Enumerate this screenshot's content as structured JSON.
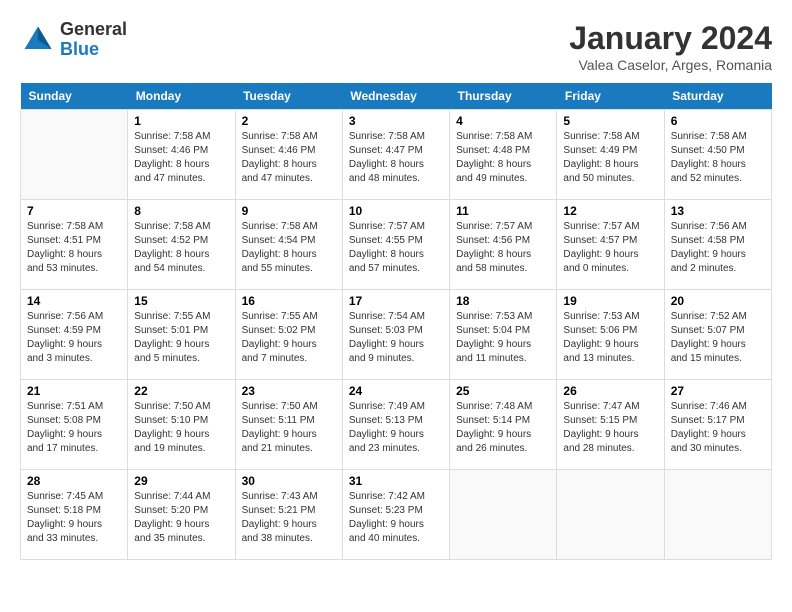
{
  "header": {
    "logo": {
      "general": "General",
      "blue": "Blue"
    },
    "title": "January 2024",
    "location": "Valea Caselor, Arges, Romania"
  },
  "days_of_week": [
    "Sunday",
    "Monday",
    "Tuesday",
    "Wednesday",
    "Thursday",
    "Friday",
    "Saturday"
  ],
  "weeks": [
    [
      {
        "day": "",
        "info": ""
      },
      {
        "day": "1",
        "info": "Sunrise: 7:58 AM\nSunset: 4:46 PM\nDaylight: 8 hours\nand 47 minutes."
      },
      {
        "day": "2",
        "info": "Sunrise: 7:58 AM\nSunset: 4:46 PM\nDaylight: 8 hours\nand 47 minutes."
      },
      {
        "day": "3",
        "info": "Sunrise: 7:58 AM\nSunset: 4:47 PM\nDaylight: 8 hours\nand 48 minutes."
      },
      {
        "day": "4",
        "info": "Sunrise: 7:58 AM\nSunset: 4:48 PM\nDaylight: 8 hours\nand 49 minutes."
      },
      {
        "day": "5",
        "info": "Sunrise: 7:58 AM\nSunset: 4:49 PM\nDaylight: 8 hours\nand 50 minutes."
      },
      {
        "day": "6",
        "info": "Sunrise: 7:58 AM\nSunset: 4:50 PM\nDaylight: 8 hours\nand 52 minutes."
      }
    ],
    [
      {
        "day": "7",
        "info": "Sunrise: 7:58 AM\nSunset: 4:51 PM\nDaylight: 8 hours\nand 53 minutes."
      },
      {
        "day": "8",
        "info": "Sunrise: 7:58 AM\nSunset: 4:52 PM\nDaylight: 8 hours\nand 54 minutes."
      },
      {
        "day": "9",
        "info": "Sunrise: 7:58 AM\nSunset: 4:54 PM\nDaylight: 8 hours\nand 55 minutes."
      },
      {
        "day": "10",
        "info": "Sunrise: 7:57 AM\nSunset: 4:55 PM\nDaylight: 8 hours\nand 57 minutes."
      },
      {
        "day": "11",
        "info": "Sunrise: 7:57 AM\nSunset: 4:56 PM\nDaylight: 8 hours\nand 58 minutes."
      },
      {
        "day": "12",
        "info": "Sunrise: 7:57 AM\nSunset: 4:57 PM\nDaylight: 9 hours\nand 0 minutes."
      },
      {
        "day": "13",
        "info": "Sunrise: 7:56 AM\nSunset: 4:58 PM\nDaylight: 9 hours\nand 2 minutes."
      }
    ],
    [
      {
        "day": "14",
        "info": "Sunrise: 7:56 AM\nSunset: 4:59 PM\nDaylight: 9 hours\nand 3 minutes."
      },
      {
        "day": "15",
        "info": "Sunrise: 7:55 AM\nSunset: 5:01 PM\nDaylight: 9 hours\nand 5 minutes."
      },
      {
        "day": "16",
        "info": "Sunrise: 7:55 AM\nSunset: 5:02 PM\nDaylight: 9 hours\nand 7 minutes."
      },
      {
        "day": "17",
        "info": "Sunrise: 7:54 AM\nSunset: 5:03 PM\nDaylight: 9 hours\nand 9 minutes."
      },
      {
        "day": "18",
        "info": "Sunrise: 7:53 AM\nSunset: 5:04 PM\nDaylight: 9 hours\nand 11 minutes."
      },
      {
        "day": "19",
        "info": "Sunrise: 7:53 AM\nSunset: 5:06 PM\nDaylight: 9 hours\nand 13 minutes."
      },
      {
        "day": "20",
        "info": "Sunrise: 7:52 AM\nSunset: 5:07 PM\nDaylight: 9 hours\nand 15 minutes."
      }
    ],
    [
      {
        "day": "21",
        "info": "Sunrise: 7:51 AM\nSunset: 5:08 PM\nDaylight: 9 hours\nand 17 minutes."
      },
      {
        "day": "22",
        "info": "Sunrise: 7:50 AM\nSunset: 5:10 PM\nDaylight: 9 hours\nand 19 minutes."
      },
      {
        "day": "23",
        "info": "Sunrise: 7:50 AM\nSunset: 5:11 PM\nDaylight: 9 hours\nand 21 minutes."
      },
      {
        "day": "24",
        "info": "Sunrise: 7:49 AM\nSunset: 5:13 PM\nDaylight: 9 hours\nand 23 minutes."
      },
      {
        "day": "25",
        "info": "Sunrise: 7:48 AM\nSunset: 5:14 PM\nDaylight: 9 hours\nand 26 minutes."
      },
      {
        "day": "26",
        "info": "Sunrise: 7:47 AM\nSunset: 5:15 PM\nDaylight: 9 hours\nand 28 minutes."
      },
      {
        "day": "27",
        "info": "Sunrise: 7:46 AM\nSunset: 5:17 PM\nDaylight: 9 hours\nand 30 minutes."
      }
    ],
    [
      {
        "day": "28",
        "info": "Sunrise: 7:45 AM\nSunset: 5:18 PM\nDaylight: 9 hours\nand 33 minutes."
      },
      {
        "day": "29",
        "info": "Sunrise: 7:44 AM\nSunset: 5:20 PM\nDaylight: 9 hours\nand 35 minutes."
      },
      {
        "day": "30",
        "info": "Sunrise: 7:43 AM\nSunset: 5:21 PM\nDaylight: 9 hours\nand 38 minutes."
      },
      {
        "day": "31",
        "info": "Sunrise: 7:42 AM\nSunset: 5:23 PM\nDaylight: 9 hours\nand 40 minutes."
      },
      {
        "day": "",
        "info": ""
      },
      {
        "day": "",
        "info": ""
      },
      {
        "day": "",
        "info": ""
      }
    ]
  ]
}
